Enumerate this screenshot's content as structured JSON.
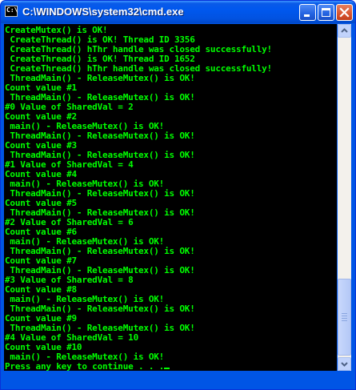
{
  "window": {
    "title": "C:\\WINDOWS\\system32\\cmd.exe",
    "icon_label": "C:\\",
    "accent": "#0055e5",
    "close_color": "#d85430"
  },
  "console": {
    "text_color": "#00ff00",
    "background": "#000000",
    "lines": [
      "CreateMutex() is OK!",
      " CreateThread() is OK! Thread ID 3356",
      " CreateThread() hThr handle was closed successfully!",
      " CreateThread() is OK! Thread ID 1652",
      " CreateThread() hThr handle was closed successfully!",
      " ThreadMain() - ReleaseMutex() is OK!",
      "Count value #1",
      " ThreadMain() - ReleaseMutex() is OK!",
      "#0 Value of SharedVal = 2",
      "Count value #2",
      " main() - ReleaseMutex() is OK!",
      " ThreadMain() - ReleaseMutex() is OK!",
      "Count value #3",
      " ThreadMain() - ReleaseMutex() is OK!",
      "#1 Value of SharedVal = 4",
      "Count value #4",
      " main() - ReleaseMutex() is OK!",
      " ThreadMain() - ReleaseMutex() is OK!",
      "Count value #5",
      " ThreadMain() - ReleaseMutex() is OK!",
      "#2 Value of SharedVal = 6",
      "Count value #6",
      " main() - ReleaseMutex() is OK!",
      " ThreadMain() - ReleaseMutex() is OK!",
      "Count value #7",
      " ThreadMain() - ReleaseMutex() is OK!",
      "#3 Value of SharedVal = 8",
      "Count value #8",
      " main() - ReleaseMutex() is OK!",
      " ThreadMain() - ReleaseMutex() is OK!",
      "Count value #9",
      " ThreadMain() - ReleaseMutex() is OK!",
      "#4 Value of SharedVal = 10",
      "Count value #10",
      " main() - ReleaseMutex() is OK!",
      "Press any key to continue . . ."
    ]
  },
  "icons": {
    "minimize": "minimize-icon",
    "maximize": "maximize-icon",
    "close": "close-icon",
    "scroll_up": "chevron-up-icon",
    "scroll_down": "chevron-down-icon"
  }
}
